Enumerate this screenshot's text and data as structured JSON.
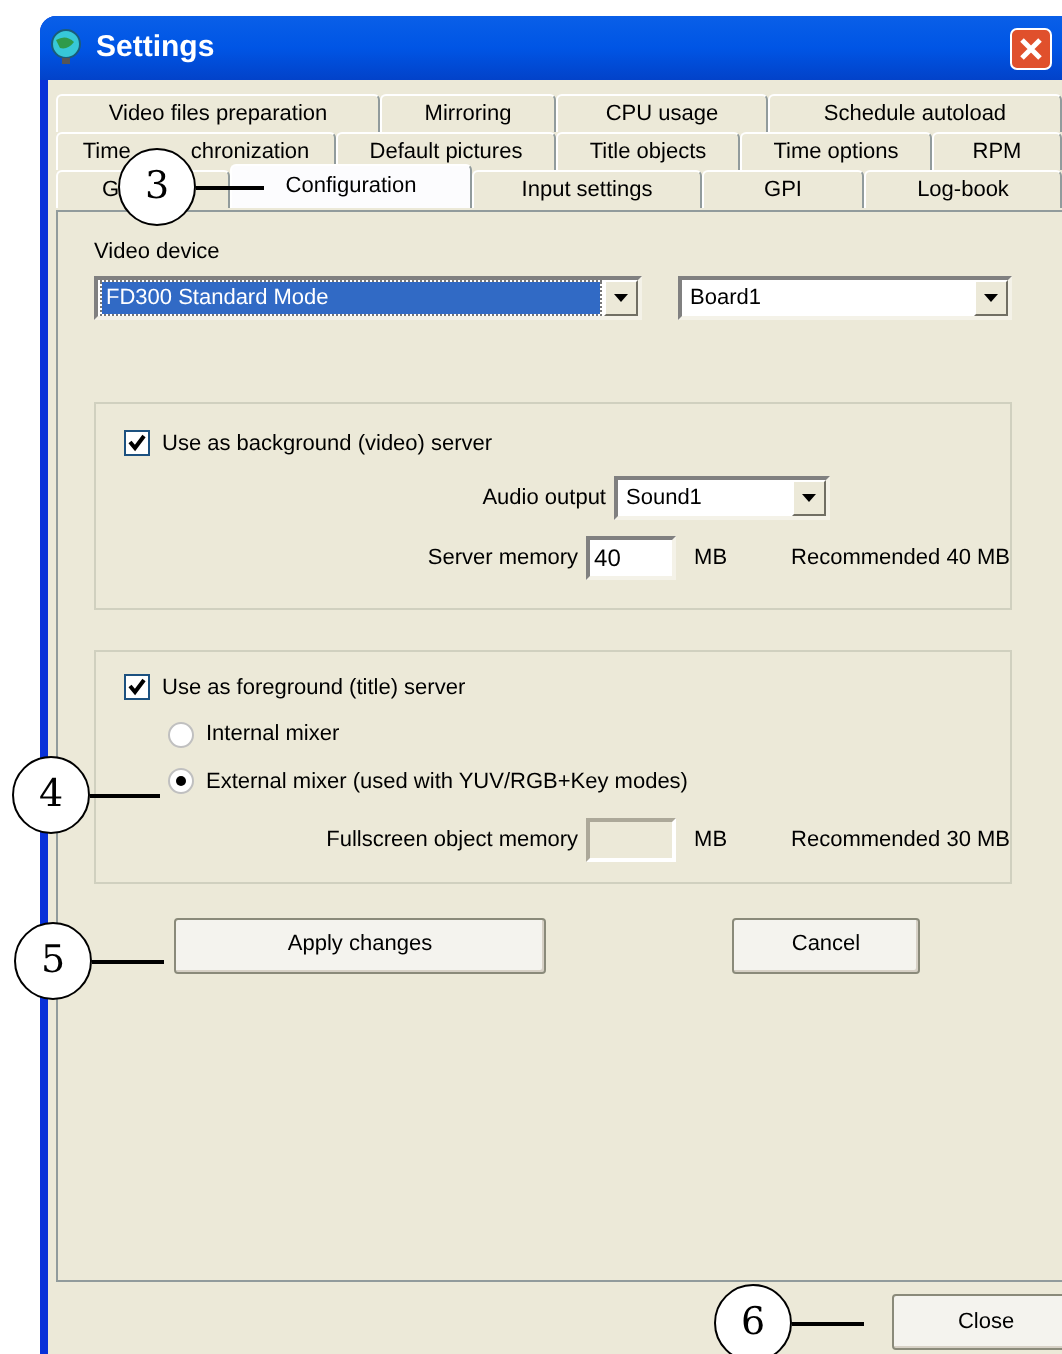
{
  "window": {
    "title": "Settings"
  },
  "tab_rows": [
    [
      {
        "label": "Video files preparation",
        "selected": false
      },
      {
        "label": "Mirroring",
        "selected": false
      },
      {
        "label": "CPU usage",
        "selected": false
      },
      {
        "label": "Schedule autoload",
        "selected": false
      }
    ],
    [
      {
        "label": "Time",
        "label_tail": "chronization",
        "selected": false
      },
      {
        "label": "Default pictures",
        "selected": false
      },
      {
        "label": "Title objects",
        "selected": false
      },
      {
        "label": "Time options",
        "selected": false
      },
      {
        "label": "RPM",
        "selected": false
      }
    ],
    [
      {
        "label": "G",
        "selected": false
      },
      {
        "label": "Configuration",
        "selected": true
      },
      {
        "label": "Input settings",
        "selected": false
      },
      {
        "label": "GPI",
        "selected": false
      },
      {
        "label": "Log-book",
        "selected": false
      }
    ]
  ],
  "video_device": {
    "label": "Video device",
    "device": "FD300 Standard Mode",
    "board": "Board1"
  },
  "background_group": {
    "checkbox": {
      "label": "Use as background (video) server",
      "checked": true
    },
    "audio_output": {
      "label": "Audio output",
      "value": "Sound1"
    },
    "server_memory": {
      "label": "Server memory",
      "value": "40",
      "unit": "MB",
      "recommended": "Recommended 40 MB"
    }
  },
  "foreground_group": {
    "checkbox": {
      "label": "Use as foreground (title) server",
      "checked": true
    },
    "mixers": [
      {
        "label": "Internal mixer",
        "selected": false
      },
      {
        "label": "External mixer (used with YUV/RGB+Key modes)",
        "selected": true
      }
    ],
    "fullscreen_memory": {
      "label": "Fullscreen object memory",
      "disabled": true,
      "unit": "MB",
      "recommended": "Recommended 30 MB"
    }
  },
  "buttons": [
    "Apply changes",
    "Cancel"
  ],
  "close_button": "Close",
  "callouts": [
    "3",
    "4",
    "5",
    "6"
  ]
}
